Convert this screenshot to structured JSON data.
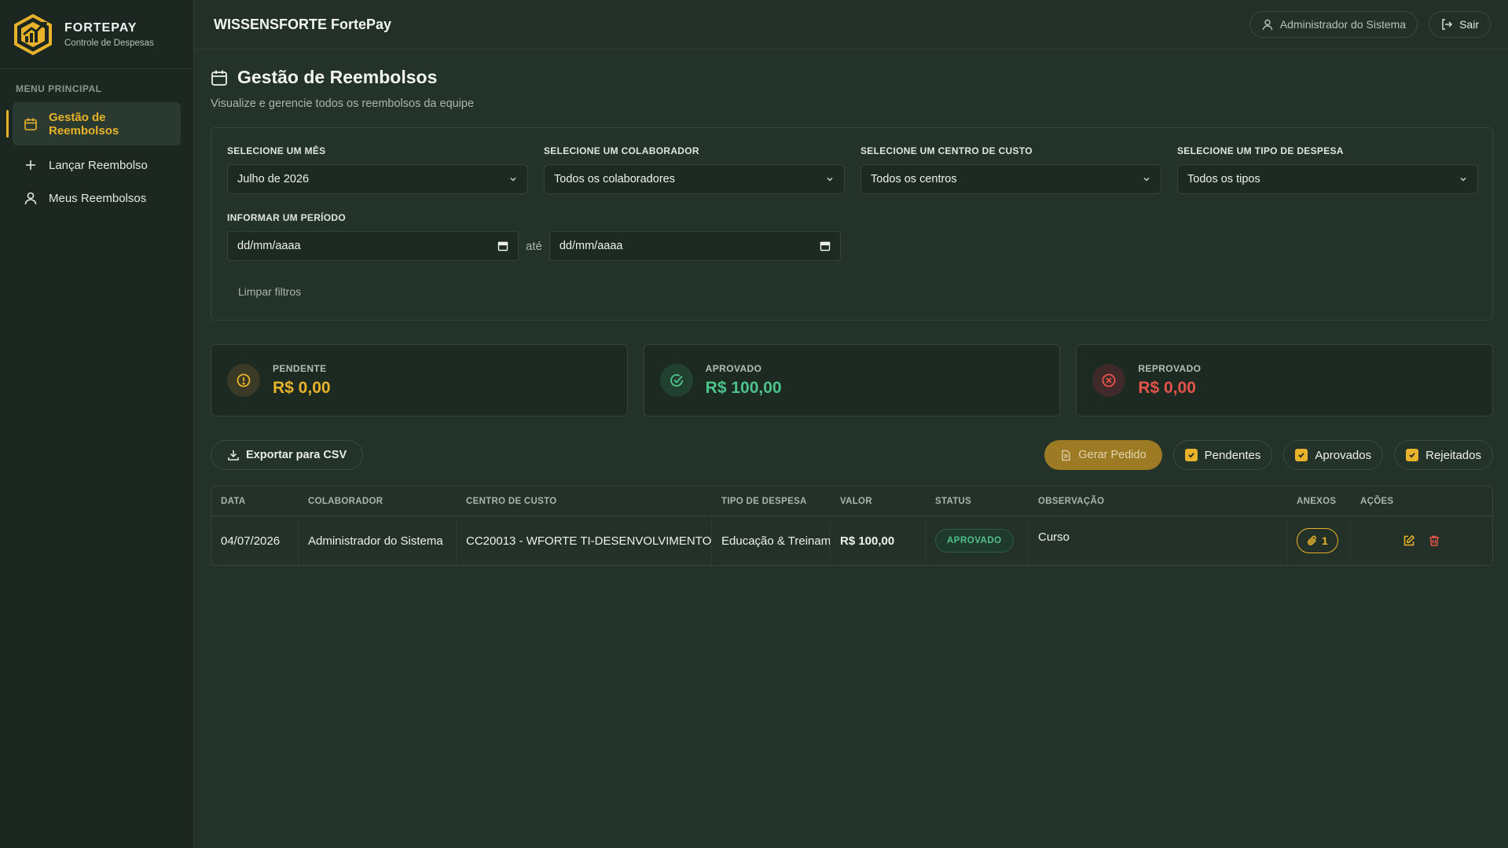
{
  "brand": {
    "name": "FORTEPAY",
    "subtitle": "Controle de Despesas"
  },
  "sidebar": {
    "menu_title": "MENU PRINCIPAL",
    "items": [
      {
        "label": "Gestão de Reembolsos",
        "icon": "calendar-icon",
        "active": true
      },
      {
        "label": "Lançar Reembolso",
        "icon": "plus-icon"
      },
      {
        "label": "Meus Reembolsos",
        "icon": "user-icon"
      }
    ]
  },
  "topbar": {
    "title": "WISSENSFORTE FortePay",
    "user": "Administrador do Sistema",
    "logout": "Sair"
  },
  "page": {
    "title": "Gestão de Reembolsos",
    "subtitle": "Visualize e gerencie todos os reembolsos da equipe"
  },
  "filters": {
    "month": {
      "label": "SELECIONE UM MÊS",
      "value": "Julho de 2026"
    },
    "collaborator": {
      "label": "SELECIONE UM COLABORADOR",
      "value": "Todos os colaboradores"
    },
    "cost_center": {
      "label": "SELECIONE UM CENTRO DE CUSTO",
      "value": "Todos os centros"
    },
    "expense_type": {
      "label": "SELECIONE UM TIPO DE DESPESA",
      "value": "Todos os tipos"
    },
    "period": {
      "label": "INFORMAR UM PERÍODO",
      "start": "dd/mm/aaaa",
      "separator": "até",
      "end": "dd/mm/aaaa"
    },
    "clear": "Limpar filtros"
  },
  "cards": {
    "pending": {
      "label": "PENDENTE",
      "value": "R$ 0,00",
      "color": "#e8b22a"
    },
    "approved": {
      "label": "APROVADO",
      "value": "R$ 100,00",
      "color": "#4cc38a"
    },
    "rejected": {
      "label": "REPROVADO",
      "value": "R$ 0,00",
      "color": "#e5534b"
    }
  },
  "actions": {
    "export": "Exportar para CSV",
    "generate": "Gerar Pedido",
    "checks": {
      "pending": "Pendentes",
      "approved": "Aprovados",
      "rejected": "Rejeitados"
    }
  },
  "table": {
    "headers": {
      "date": "DATA",
      "collaborator": "COLABORADOR",
      "cost_center": "CENTRO DE CUSTO",
      "type": "TIPO DE DESPESA",
      "value": "VALOR",
      "status": "STATUS",
      "note": "OBSERVAÇÃO",
      "attachments": "ANEXOS",
      "actions": "AÇÕES"
    },
    "rows": [
      {
        "date": "04/07/2026",
        "collaborator": "Administrador do Sistema",
        "cost_center": "CC20013 - WFORTE TI-DESENVOLVIMENTO",
        "type": "Educação & Treinam",
        "value": "R$ 100,00",
        "status": "APROVADO",
        "note": "Curso",
        "attachments": "1"
      }
    ]
  },
  "colors": {
    "accent": "#e8b22a",
    "background": "#243329",
    "sidebar": "#1b2720"
  }
}
